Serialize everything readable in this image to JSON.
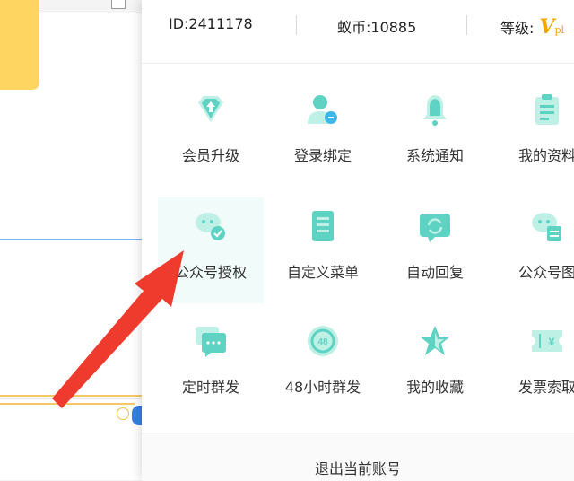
{
  "account": {
    "id_text": "ID:2411178",
    "coins_text": "蚁币:10885",
    "level_label": "等级:",
    "level_badge": "V",
    "level_badge_suffix": "pl"
  },
  "menu_items": [
    {
      "label": "会员升级",
      "icon": "diamond-upgrade-icon"
    },
    {
      "label": "登录绑定",
      "icon": "user-bind-icon"
    },
    {
      "label": "系统通知",
      "icon": "bell-icon"
    },
    {
      "label": "我的资料",
      "icon": "clipboard-icon"
    },
    {
      "label": "公众号授权",
      "icon": "wechat-auth-icon"
    },
    {
      "label": "自定义菜单",
      "icon": "list-menu-icon"
    },
    {
      "label": "自动回复",
      "icon": "auto-reply-icon"
    },
    {
      "label": "公众号图",
      "icon": "wechat-doc-icon"
    },
    {
      "label": "定时群发",
      "icon": "scheduled-broadcast-icon"
    },
    {
      "label": "48小时群发",
      "icon": "48h-icon"
    },
    {
      "label": "我的收藏",
      "icon": "star-icon"
    },
    {
      "label": "发票索取",
      "icon": "invoice-ticket-icon"
    }
  ],
  "logout": {
    "label": "退出当前账号"
  },
  "colors": {
    "icon_light": "#bff0e6",
    "icon_main": "#5ed3c3",
    "icon_accent": "#3eb7e8",
    "arrow": "#ef3b2d",
    "level_gold": "#f2a400"
  }
}
